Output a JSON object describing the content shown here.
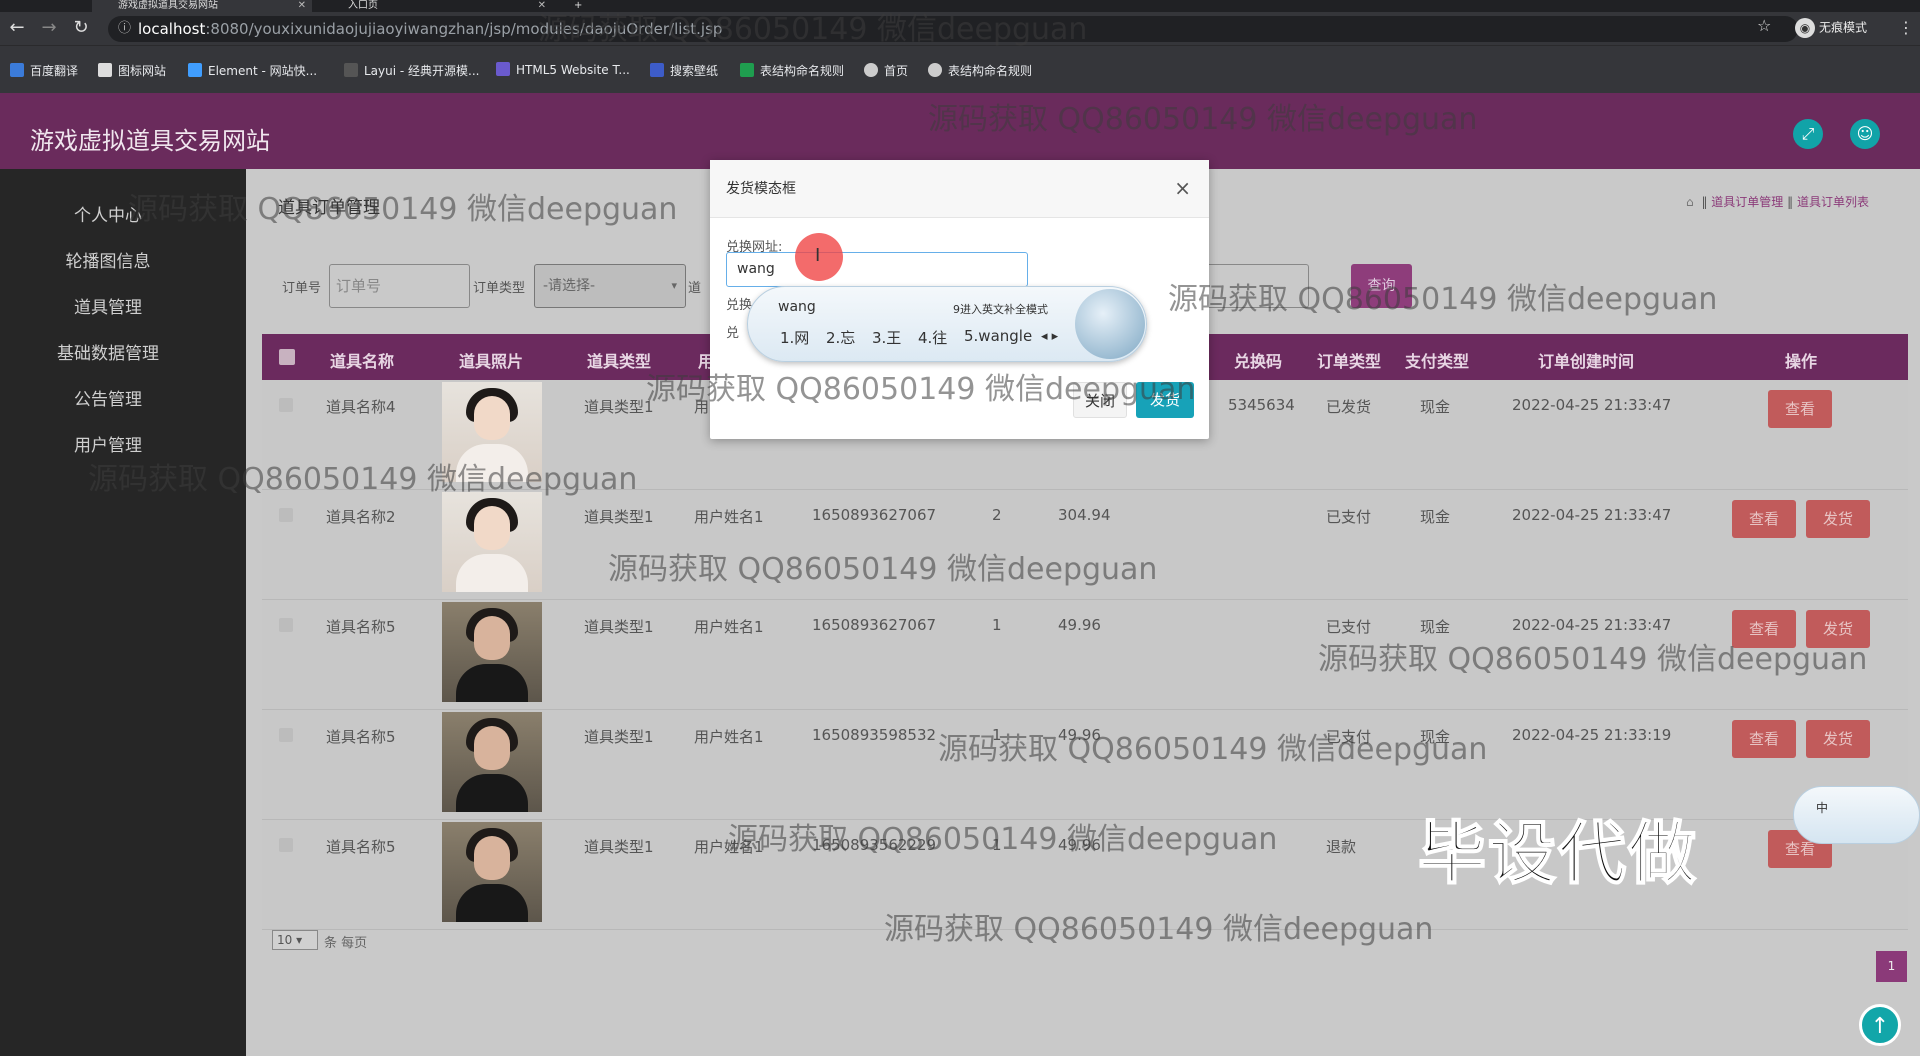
{
  "browser": {
    "tabs": [
      {
        "title": "游戏虚拟道具交易网站"
      },
      {
        "title": "入口页"
      }
    ],
    "new_tab": "+",
    "url_host": "localhost",
    "url_rest": ":8080/youxixunidaojujiaoyiwangzhan/jsp/modules/daojuOrder/list.jsp",
    "incognito_label": "无痕模式",
    "bookmarks": [
      "百度翻译",
      "图标网站",
      "Element - 网站快...",
      "Layui - 经典开源模...",
      "HTML5 Website T...",
      "搜索壁纸",
      "表结构命名规则",
      "首页",
      "表结构命名规则"
    ]
  },
  "app": {
    "title": "游戏虚拟道具交易网站"
  },
  "sidebar": {
    "items": [
      "个人中心",
      "轮播图信息",
      "道具管理",
      "基础数据管理",
      "公告管理",
      "用户管理"
    ]
  },
  "breadcrumb": {
    "page_title": "道具订单管理",
    "path_a": "道具订单管理",
    "path_b": "道具订单列表",
    "sep": "‖"
  },
  "search": {
    "order_no_label": "订单号",
    "order_no_placeholder": "订单号",
    "order_type_label": "订单类型",
    "order_type_selected": "-请选择-",
    "extra_label": "道",
    "button": "查询"
  },
  "table": {
    "headers": [
      "道具名称",
      "道具照片",
      "道具类型",
      "用",
      "兑换码",
      "订单类型",
      "支付类型",
      "订单创建时间",
      "操作"
    ],
    "rows": [
      {
        "name": "道具名称4",
        "type": "道具类型1",
        "user": "用",
        "order_no": "",
        "qty": "",
        "price": "",
        "code": "5345634",
        "status": "已发货",
        "pay": "现金",
        "time": "2022-04-25 21:33:47",
        "photo": "f",
        "actions": [
          "查看"
        ]
      },
      {
        "name": "道具名称2",
        "type": "道具类型1",
        "user": "用户姓名1",
        "order_no": "1650893627067",
        "qty": "2",
        "price": "304.94",
        "code": "",
        "status": "已支付",
        "pay": "现金",
        "time": "2022-04-25 21:33:47",
        "photo": "f",
        "actions": [
          "查看",
          "发货"
        ]
      },
      {
        "name": "道具名称5",
        "type": "道具类型1",
        "user": "用户姓名1",
        "order_no": "1650893627067",
        "qty": "1",
        "price": "49.96",
        "code": "",
        "status": "已支付",
        "pay": "现金",
        "time": "2022-04-25 21:33:47",
        "photo": "m",
        "actions": [
          "查看",
          "发货"
        ]
      },
      {
        "name": "道具名称5",
        "type": "道具类型1",
        "user": "用户姓名1",
        "order_no": "1650893598532",
        "qty": "1",
        "price": "49.96",
        "code": "",
        "status": "已支付",
        "pay": "现金",
        "time": "2022-04-25 21:33:19",
        "photo": "m",
        "actions": [
          "查看",
          "发货"
        ]
      },
      {
        "name": "道具名称5",
        "type": "道具类型1",
        "user": "用户姓名1",
        "order_no": "1650893562229",
        "qty": "1",
        "price": "49.96",
        "code": "",
        "status": "退款",
        "pay": "",
        "time": "",
        "photo": "m",
        "actions": [
          "查看"
        ]
      }
    ]
  },
  "pagination": {
    "page_size": "10",
    "per_page_label": "条 每页",
    "current_page": "1"
  },
  "modal": {
    "title": "发货模态框",
    "close_symbol": "×",
    "field1_label": "兑换网址:",
    "field1_value": "wang",
    "field2_label": "兑换",
    "field3_label": "兑",
    "close_button": "关闭",
    "ship_button": "发货"
  },
  "ime": {
    "composition": "wang",
    "hint": "9进入英文补全模式",
    "candidates": [
      "1.网",
      "2.忘",
      "3.王",
      "4.往",
      "5.wangle"
    ],
    "arrows": "◂ ▸",
    "float_label": "中"
  },
  "watermark": "源码获取 QQ86050149 微信deepguan",
  "overlay_text": "毕设代做"
}
